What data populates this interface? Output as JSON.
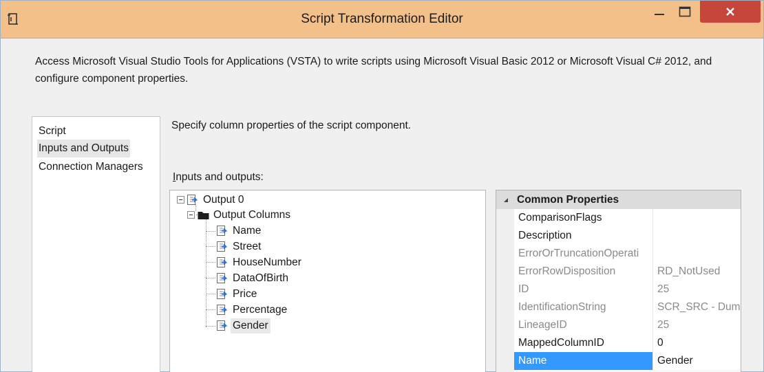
{
  "window": {
    "title": "Script Transformation Editor",
    "close_label": "×"
  },
  "description": "Access Microsoft Visual Studio Tools for Applications (VSTA) to write scripts using Microsoft Visual Basic 2012 or Microsoft Visual C# 2012, and configure component properties.",
  "nav": {
    "items": [
      {
        "label": "Script"
      },
      {
        "label": "Inputs and Outputs",
        "selected": true
      },
      {
        "label": "Connection Managers"
      }
    ]
  },
  "main": {
    "hint": "Specify column properties of the script component.",
    "io_label_accel": "I",
    "io_label_rest": "nputs and outputs:"
  },
  "tree": {
    "output": "Output 0",
    "folder": "Output Columns",
    "columns": [
      "Name",
      "Street",
      "HouseNumber",
      "DataOfBirth",
      "Price",
      "Percentage",
      "Gender"
    ],
    "selected_column": "Gender"
  },
  "properties": {
    "category": "Common Properties",
    "rows": [
      {
        "name": "ComparisonFlags",
        "value": "",
        "readonly": false
      },
      {
        "name": "Description",
        "value": "",
        "readonly": false
      },
      {
        "name": "ErrorOrTruncationOperati",
        "value": "",
        "readonly": true
      },
      {
        "name": "ErrorRowDisposition",
        "value": "RD_NotUsed",
        "readonly": true
      },
      {
        "name": "ID",
        "value": "25",
        "readonly": true
      },
      {
        "name": "IdentificationString",
        "value": "SCR_SRC - Dumi",
        "readonly": true
      },
      {
        "name": "LineageID",
        "value": "25",
        "readonly": true
      },
      {
        "name": "MappedColumnID",
        "value": "0",
        "readonly": false
      },
      {
        "name": "Name",
        "value": "Gender",
        "readonly": false,
        "selected": true
      }
    ]
  },
  "colors": {
    "titlebar": "#f3c089",
    "close_button": "#c7463c",
    "selection": "#3399ff"
  }
}
